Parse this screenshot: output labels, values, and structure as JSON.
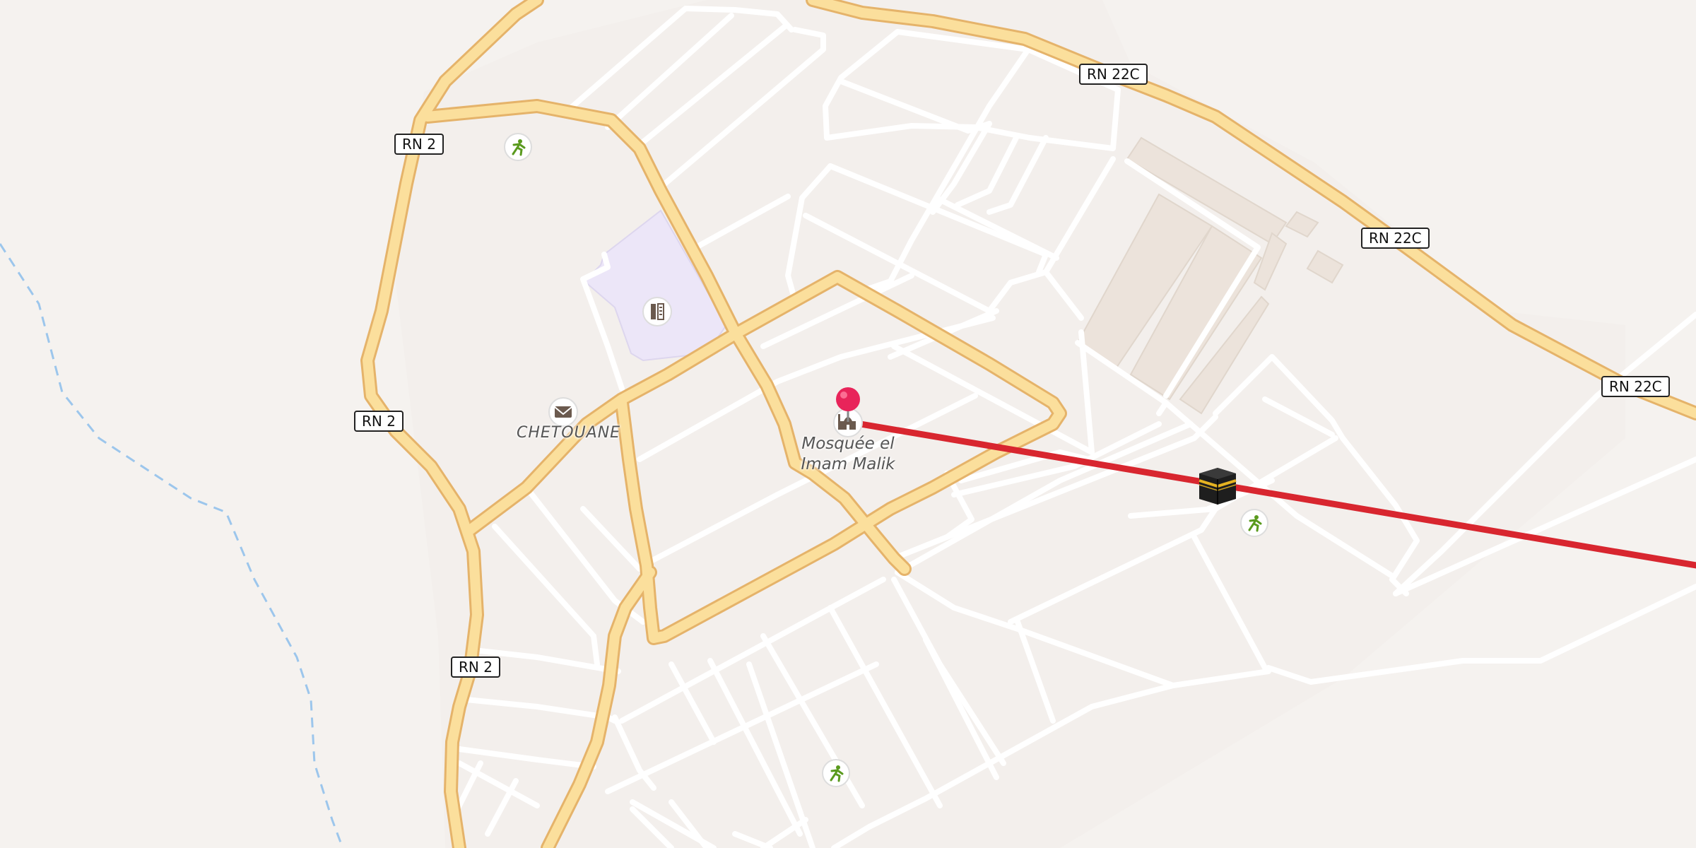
{
  "map": {
    "background_color": "#f5f2ef",
    "colors": {
      "primary_road_fill": "#fbdf9c",
      "primary_road_casing": "#e5b36a",
      "minor_road": "#ffffff",
      "residential_area": "#f3efec",
      "school_area": "#ece6f8",
      "building": "#ece3db",
      "route_line": "#d8262f",
      "marker_pin": "#e8245a",
      "stream": "#9cc6ec",
      "poi_icon": "#6b5a4e",
      "park_icon": "#5a9a1e"
    },
    "road_shields": [
      {
        "id": "rn22c-a",
        "label": "RN 22C"
      },
      {
        "id": "rn22c-b",
        "label": "RN 22C"
      },
      {
        "id": "rn22c-c",
        "label": "RN 22C"
      },
      {
        "id": "rn2-a",
        "label": "RN 2"
      },
      {
        "id": "rn2-b",
        "label": "RN 2"
      },
      {
        "id": "rn2-c",
        "label": "RN 2"
      }
    ],
    "place_label": "CHETOUANE",
    "poi_label": {
      "line1": "Mosquée el",
      "line2": "Imam Malik"
    },
    "icons": [
      "sport-icon",
      "school-icon",
      "post-office-icon",
      "mosque-icon",
      "kaaba-icon",
      "map-pin-icon"
    ]
  }
}
